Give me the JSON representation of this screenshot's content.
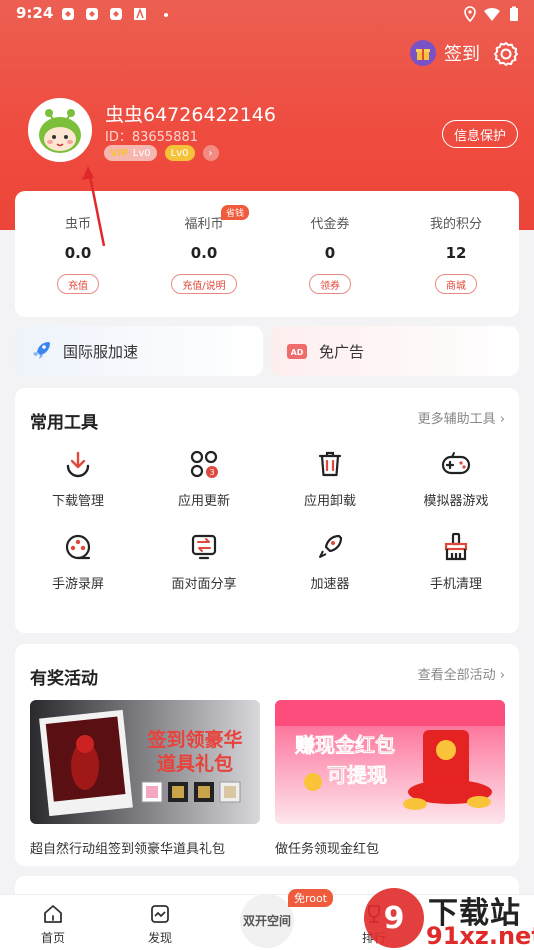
{
  "status": {
    "time": "9:24"
  },
  "header": {
    "signin_label": "签到",
    "protect_label": "信息保护"
  },
  "user": {
    "name": "虫虫64726422146",
    "id": "ID：83655881",
    "vip_badge": "VIP",
    "vip_level": "Lv0",
    "level": "Lv0"
  },
  "wallet": [
    {
      "label": "虫币",
      "value": "0.0",
      "button": "充值"
    },
    {
      "label": "福利币",
      "value": "0.0",
      "button": "充值/说明",
      "tag": "省钱"
    },
    {
      "label": "代金券",
      "value": "0",
      "button": "领券"
    },
    {
      "label": "我的积分",
      "value": "12",
      "button": "商城"
    }
  ],
  "quick": {
    "left": "国际服加速",
    "right": "免广告"
  },
  "tools": {
    "title": "常用工具",
    "more": "更多辅助工具",
    "items": [
      {
        "label": "下载管理",
        "icon": "download-icon"
      },
      {
        "label": "应用更新",
        "icon": "app-update-icon",
        "badge": "3"
      },
      {
        "label": "应用卸载",
        "icon": "trash-icon"
      },
      {
        "label": "模拟器游戏",
        "icon": "gamepad-icon"
      },
      {
        "label": "手游录屏",
        "icon": "record-icon"
      },
      {
        "label": "面对面分享",
        "icon": "share-icon"
      },
      {
        "label": "加速器",
        "icon": "rocket-icon"
      },
      {
        "label": "手机清理",
        "icon": "broom-icon"
      }
    ]
  },
  "activities": {
    "title": "有奖活动",
    "more": "查看全部活动",
    "items": [
      {
        "caption": "超自然行动组签到领豪华道具礼包",
        "banner_line1": "签到领豪华",
        "banner_line2": "道具礼包"
      },
      {
        "caption": "做任务领现金红包",
        "banner_line1": "赚现金红包",
        "banner_line2": "可提现"
      }
    ]
  },
  "tabbar": {
    "home": "首页",
    "discover": "发现",
    "dual": "双开空间",
    "rank": "排行",
    "free_root": "免root"
  },
  "watermark": {
    "line1": "下载站",
    "line2": "91xz.net"
  },
  "colors": {
    "brand": "#ee4b3e",
    "accent": "#f05b3c"
  }
}
